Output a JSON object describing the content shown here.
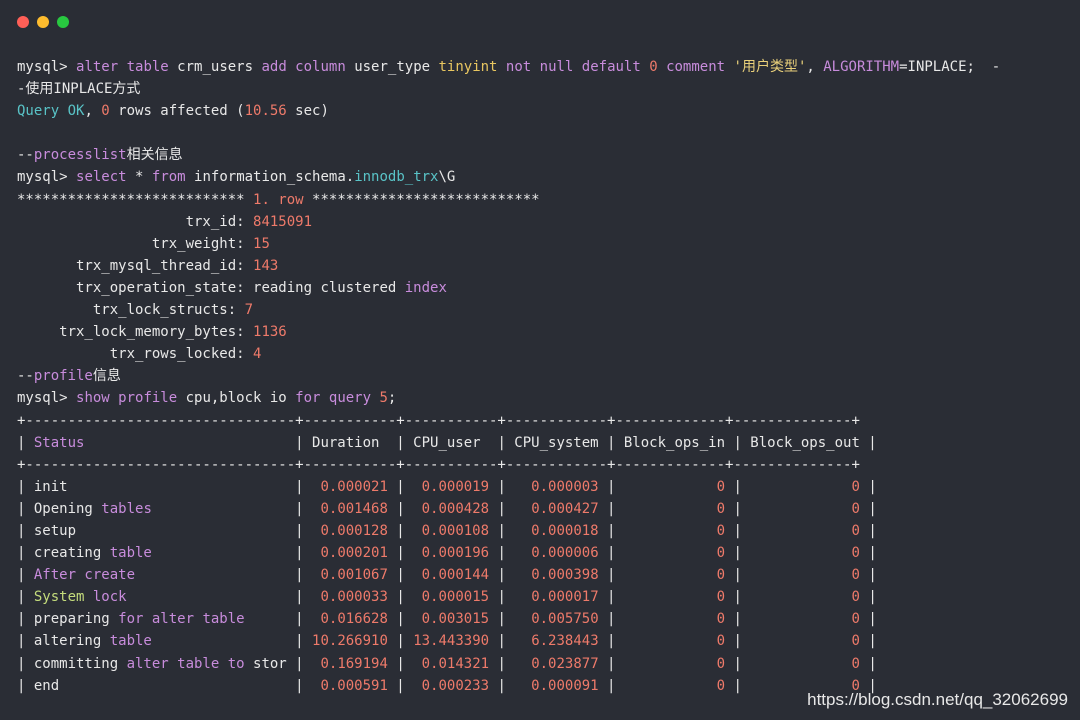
{
  "colors": {
    "default": "#e8e8e8",
    "keyword": "#c88cdc",
    "type": "#e8c660",
    "number": "#ee7a6a",
    "string": "#e9d07a",
    "teal": "#59c3c7",
    "sysfn": "#c4dc7c",
    "bg": "#2a2d35"
  },
  "window": {
    "buttons": [
      "close",
      "minimize",
      "zoom"
    ]
  },
  "terminal": {
    "lines": [
      {
        "role": "command",
        "segments": [
          {
            "t": "mysql> ",
            "c": "default"
          },
          {
            "t": "alter table ",
            "c": "keyword"
          },
          {
            "t": "crm_users ",
            "c": "default"
          },
          {
            "t": "add column ",
            "c": "keyword"
          },
          {
            "t": "user_type ",
            "c": "default"
          },
          {
            "t": "tinyint ",
            "c": "type"
          },
          {
            "t": "not null default ",
            "c": "keyword"
          },
          {
            "t": "0 ",
            "c": "number"
          },
          {
            "t": "comment ",
            "c": "keyword"
          },
          {
            "t": "'用户类型'",
            "c": "string"
          },
          {
            "t": ", ",
            "c": "default"
          },
          {
            "t": "ALGORITHM",
            "c": "keyword"
          },
          {
            "t": "=INPLACE;  -",
            "c": "default"
          }
        ]
      },
      {
        "role": "comment",
        "segments": [
          {
            "t": "-使用INPLACE方式",
            "c": "default"
          }
        ]
      },
      {
        "role": "output",
        "segments": [
          {
            "t": "Query OK",
            "c": "teal"
          },
          {
            "t": ", ",
            "c": "default"
          },
          {
            "t": "0",
            "c": "number"
          },
          {
            "t": " rows affected (",
            "c": "default"
          },
          {
            "t": "10.56",
            "c": "number"
          },
          {
            "t": " sec)",
            "c": "default"
          }
        ]
      },
      {
        "role": "blank",
        "segments": []
      },
      {
        "role": "comment",
        "segments": [
          {
            "t": "--",
            "c": "default"
          },
          {
            "t": "processlist",
            "c": "keyword"
          },
          {
            "t": "相关信息",
            "c": "default"
          }
        ]
      },
      {
        "role": "command",
        "segments": [
          {
            "t": "mysql> ",
            "c": "default"
          },
          {
            "t": "select ",
            "c": "keyword"
          },
          {
            "t": "* ",
            "c": "default"
          },
          {
            "t": "from ",
            "c": "keyword"
          },
          {
            "t": "information_schema.",
            "c": "default"
          },
          {
            "t": "innodb_trx",
            "c": "teal"
          },
          {
            "t": "\\G",
            "c": "default"
          }
        ]
      },
      {
        "role": "output",
        "segments": [
          {
            "t": "*************************** ",
            "c": "default"
          },
          {
            "t": "1. row ",
            "c": "number"
          },
          {
            "t": "***************************",
            "c": "default"
          }
        ]
      },
      {
        "role": "output",
        "segments": [
          {
            "t": "                    trx_id: ",
            "c": "default"
          },
          {
            "t": "8415091",
            "c": "number"
          }
        ]
      },
      {
        "role": "output",
        "segments": [
          {
            "t": "                trx_weight: ",
            "c": "default"
          },
          {
            "t": "15",
            "c": "number"
          }
        ]
      },
      {
        "role": "output",
        "segments": [
          {
            "t": "       trx_mysql_thread_id: ",
            "c": "default"
          },
          {
            "t": "143",
            "c": "number"
          }
        ]
      },
      {
        "role": "output",
        "segments": [
          {
            "t": "       trx_operation_state: ",
            "c": "default"
          },
          {
            "t": "reading clustered ",
            "c": "default"
          },
          {
            "t": "index",
            "c": "keyword"
          }
        ]
      },
      {
        "role": "output",
        "segments": [
          {
            "t": "         trx_lock_structs: ",
            "c": "default"
          },
          {
            "t": "7",
            "c": "number"
          }
        ]
      },
      {
        "role": "output",
        "segments": [
          {
            "t": "     trx_lock_memory_bytes: ",
            "c": "default"
          },
          {
            "t": "1136",
            "c": "number"
          }
        ]
      },
      {
        "role": "output",
        "segments": [
          {
            "t": "           trx_rows_locked: ",
            "c": "default"
          },
          {
            "t": "4",
            "c": "number"
          }
        ]
      },
      {
        "role": "comment",
        "segments": [
          {
            "t": "--",
            "c": "default"
          },
          {
            "t": "profile",
            "c": "keyword"
          },
          {
            "t": "信息",
            "c": "default"
          }
        ]
      },
      {
        "role": "command",
        "segments": [
          {
            "t": "mysql> ",
            "c": "default"
          },
          {
            "t": "show profile ",
            "c": "keyword"
          },
          {
            "t": "cpu,block io ",
            "c": "default"
          },
          {
            "t": "for query ",
            "c": "keyword"
          },
          {
            "t": "5",
            "c": "number"
          },
          {
            "t": ";",
            "c": "default"
          }
        ]
      },
      {
        "role": "border",
        "segments": [
          {
            "t": "+--------------------------------+-----------+-----------+------------+-------------+--------------+",
            "c": "default"
          }
        ]
      },
      {
        "role": "table-header",
        "segments": [
          {
            "t": "| ",
            "c": "default"
          },
          {
            "t": "Status",
            "c": "keyword"
          },
          {
            "t": "                         | Duration  | CPU_user  | CPU_system | Block_ops_in | Block_ops_out |",
            "c": "default"
          }
        ]
      },
      {
        "role": "border",
        "segments": [
          {
            "t": "+--------------------------------+-----------+-----------+------------+-------------+--------------+",
            "c": "default"
          }
        ]
      },
      {
        "role": "table-row",
        "segments": [
          {
            "t": "| init                           | ",
            "c": "default"
          },
          {
            "t": " 0.000021",
            "c": "number"
          },
          {
            "t": " | ",
            "c": "default"
          },
          {
            "t": " 0.000019",
            "c": "number"
          },
          {
            "t": " |  ",
            "c": "default"
          },
          {
            "t": " 0.000003",
            "c": "number"
          },
          {
            "t": " |            ",
            "c": "default"
          },
          {
            "t": "0",
            "c": "number"
          },
          {
            "t": " |             ",
            "c": "default"
          },
          {
            "t": "0",
            "c": "number"
          },
          {
            "t": " |",
            "c": "default"
          }
        ]
      },
      {
        "role": "table-row",
        "segments": [
          {
            "t": "| Opening ",
            "c": "default"
          },
          {
            "t": "tables",
            "c": "keyword"
          },
          {
            "t": "                 | ",
            "c": "default"
          },
          {
            "t": " 0.001468",
            "c": "number"
          },
          {
            "t": " | ",
            "c": "default"
          },
          {
            "t": " 0.000428",
            "c": "number"
          },
          {
            "t": " |  ",
            "c": "default"
          },
          {
            "t": " 0.000427",
            "c": "number"
          },
          {
            "t": " |            ",
            "c": "default"
          },
          {
            "t": "0",
            "c": "number"
          },
          {
            "t": " |             ",
            "c": "default"
          },
          {
            "t": "0",
            "c": "number"
          },
          {
            "t": " |",
            "c": "default"
          }
        ]
      },
      {
        "role": "table-row",
        "segments": [
          {
            "t": "| setup                          | ",
            "c": "default"
          },
          {
            "t": " 0.000128",
            "c": "number"
          },
          {
            "t": " | ",
            "c": "default"
          },
          {
            "t": " 0.000108",
            "c": "number"
          },
          {
            "t": " |  ",
            "c": "default"
          },
          {
            "t": " 0.000018",
            "c": "number"
          },
          {
            "t": " |            ",
            "c": "default"
          },
          {
            "t": "0",
            "c": "number"
          },
          {
            "t": " |             ",
            "c": "default"
          },
          {
            "t": "0",
            "c": "number"
          },
          {
            "t": " |",
            "c": "default"
          }
        ]
      },
      {
        "role": "table-row",
        "segments": [
          {
            "t": "| creating ",
            "c": "default"
          },
          {
            "t": "table",
            "c": "keyword"
          },
          {
            "t": "                 | ",
            "c": "default"
          },
          {
            "t": " 0.000201",
            "c": "number"
          },
          {
            "t": " | ",
            "c": "default"
          },
          {
            "t": " 0.000196",
            "c": "number"
          },
          {
            "t": " |  ",
            "c": "default"
          },
          {
            "t": " 0.000006",
            "c": "number"
          },
          {
            "t": " |            ",
            "c": "default"
          },
          {
            "t": "0",
            "c": "number"
          },
          {
            "t": " |             ",
            "c": "default"
          },
          {
            "t": "0",
            "c": "number"
          },
          {
            "t": " |",
            "c": "default"
          }
        ]
      },
      {
        "role": "table-row",
        "segments": [
          {
            "t": "| ",
            "c": "default"
          },
          {
            "t": "After create",
            "c": "keyword"
          },
          {
            "t": "                   | ",
            "c": "default"
          },
          {
            "t": " 0.001067",
            "c": "number"
          },
          {
            "t": " | ",
            "c": "default"
          },
          {
            "t": " 0.000144",
            "c": "number"
          },
          {
            "t": " |  ",
            "c": "default"
          },
          {
            "t": " 0.000398",
            "c": "number"
          },
          {
            "t": " |            ",
            "c": "default"
          },
          {
            "t": "0",
            "c": "number"
          },
          {
            "t": " |             ",
            "c": "default"
          },
          {
            "t": "0",
            "c": "number"
          },
          {
            "t": " |",
            "c": "default"
          }
        ]
      },
      {
        "role": "table-row",
        "segments": [
          {
            "t": "| ",
            "c": "default"
          },
          {
            "t": "System",
            "c": "sysfn"
          },
          {
            "t": " ",
            "c": "default"
          },
          {
            "t": "lock",
            "c": "keyword"
          },
          {
            "t": "                    | ",
            "c": "default"
          },
          {
            "t": " 0.000033",
            "c": "number"
          },
          {
            "t": " | ",
            "c": "default"
          },
          {
            "t": " 0.000015",
            "c": "number"
          },
          {
            "t": " |  ",
            "c": "default"
          },
          {
            "t": " 0.000017",
            "c": "number"
          },
          {
            "t": " |            ",
            "c": "default"
          },
          {
            "t": "0",
            "c": "number"
          },
          {
            "t": " |             ",
            "c": "default"
          },
          {
            "t": "0",
            "c": "number"
          },
          {
            "t": " |",
            "c": "default"
          }
        ]
      },
      {
        "role": "table-row",
        "segments": [
          {
            "t": "| preparing ",
            "c": "default"
          },
          {
            "t": "for alter table",
            "c": "keyword"
          },
          {
            "t": "      | ",
            "c": "default"
          },
          {
            "t": " 0.016628",
            "c": "number"
          },
          {
            "t": " | ",
            "c": "default"
          },
          {
            "t": " 0.003015",
            "c": "number"
          },
          {
            "t": " |  ",
            "c": "default"
          },
          {
            "t": " 0.005750",
            "c": "number"
          },
          {
            "t": " |            ",
            "c": "default"
          },
          {
            "t": "0",
            "c": "number"
          },
          {
            "t": " |             ",
            "c": "default"
          },
          {
            "t": "0",
            "c": "number"
          },
          {
            "t": " |",
            "c": "default"
          }
        ]
      },
      {
        "role": "table-row",
        "segments": [
          {
            "t": "| altering ",
            "c": "default"
          },
          {
            "t": "table",
            "c": "keyword"
          },
          {
            "t": "                 | ",
            "c": "default"
          },
          {
            "t": "10.266910",
            "c": "number"
          },
          {
            "t": " | ",
            "c": "default"
          },
          {
            "t": "13.443390",
            "c": "number"
          },
          {
            "t": " |  ",
            "c": "default"
          },
          {
            "t": " 6.238443",
            "c": "number"
          },
          {
            "t": " |            ",
            "c": "default"
          },
          {
            "t": "0",
            "c": "number"
          },
          {
            "t": " |             ",
            "c": "default"
          },
          {
            "t": "0",
            "c": "number"
          },
          {
            "t": " |",
            "c": "default"
          }
        ]
      },
      {
        "role": "table-row",
        "segments": [
          {
            "t": "| committing ",
            "c": "default"
          },
          {
            "t": "alter table to",
            "c": "keyword"
          },
          {
            "t": " stor | ",
            "c": "default"
          },
          {
            "t": " 0.169194",
            "c": "number"
          },
          {
            "t": " | ",
            "c": "default"
          },
          {
            "t": " 0.014321",
            "c": "number"
          },
          {
            "t": " |  ",
            "c": "default"
          },
          {
            "t": " 0.023877",
            "c": "number"
          },
          {
            "t": " |            ",
            "c": "default"
          },
          {
            "t": "0",
            "c": "number"
          },
          {
            "t": " |             ",
            "c": "default"
          },
          {
            "t": "0",
            "c": "number"
          },
          {
            "t": " |",
            "c": "default"
          }
        ]
      },
      {
        "role": "table-row",
        "segments": [
          {
            "t": "| end                            | ",
            "c": "default"
          },
          {
            "t": " 0.000591",
            "c": "number"
          },
          {
            "t": " | ",
            "c": "default"
          },
          {
            "t": " 0.000233",
            "c": "number"
          },
          {
            "t": " |  ",
            "c": "default"
          },
          {
            "t": " 0.000091",
            "c": "number"
          },
          {
            "t": " |            ",
            "c": "default"
          },
          {
            "t": "0",
            "c": "number"
          },
          {
            "t": " |             ",
            "c": "default"
          },
          {
            "t": "0",
            "c": "number"
          },
          {
            "t": " |",
            "c": "default"
          }
        ]
      }
    ]
  },
  "watermark": {
    "text": "https://blog.csdn.net/qq_32062699"
  }
}
